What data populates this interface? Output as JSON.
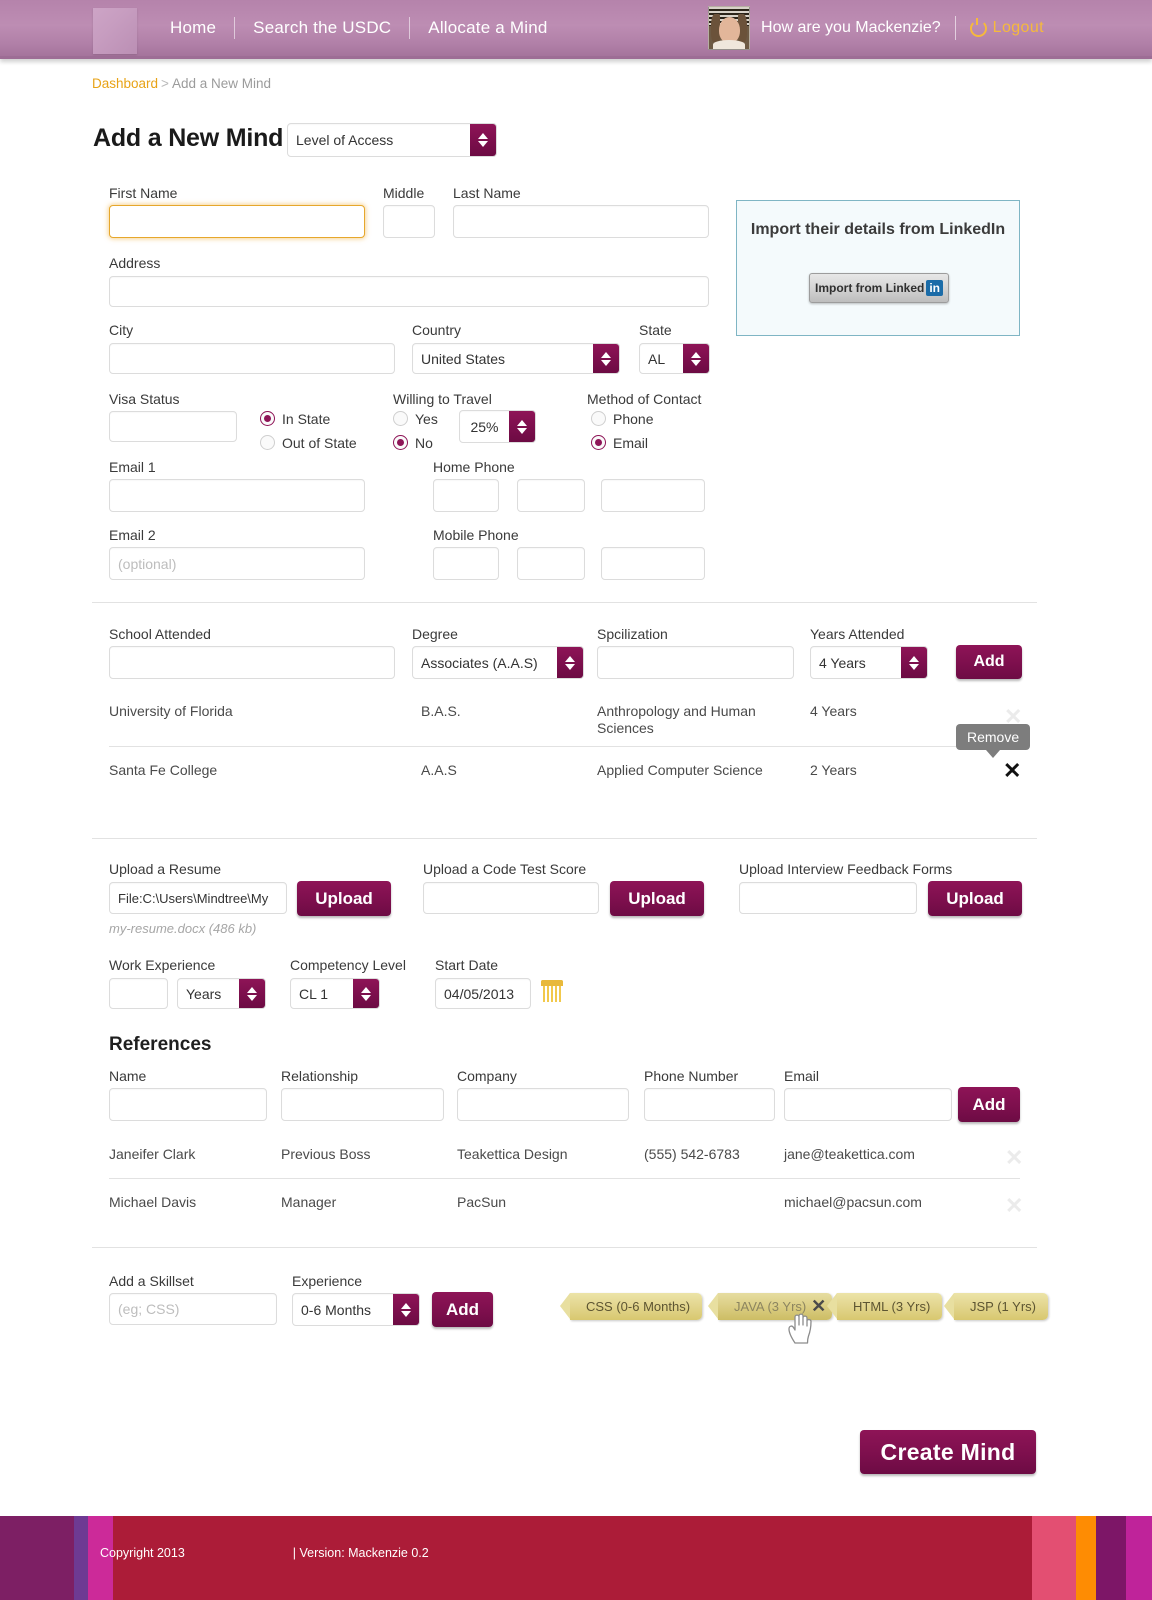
{
  "header": {
    "nav": [
      {
        "label": "Home",
        "name": "nav-home"
      },
      {
        "label": "Search the USDC",
        "name": "nav-search-usdc"
      },
      {
        "label": "Allocate a Mind",
        "name": "nav-allocate-a-mind"
      }
    ],
    "greeting": "How are you Mackenzie?",
    "logout_label": "Logout",
    "accent": "#b583ab",
    "logout_color": "#f6b93b"
  },
  "breadcrumb": {
    "root": "Dashboard",
    "sep": ">",
    "current": "Add a New Mind"
  },
  "page": {
    "title": "Add a New Mind",
    "access_select": "Level of Access"
  },
  "personal": {
    "first_name": {
      "label": "First Name",
      "value": ""
    },
    "middle": {
      "label": "Middle",
      "value": ""
    },
    "last_name": {
      "label": "Last Name",
      "value": ""
    },
    "address": {
      "label": "Address",
      "value": ""
    },
    "city": {
      "label": "City",
      "value": ""
    },
    "country": {
      "label": "Country",
      "value": "United States"
    },
    "state": {
      "label": "State",
      "value": "AL"
    },
    "visa_status": {
      "label": "Visa Status",
      "value": ""
    },
    "state_radio": [
      {
        "label": "In State",
        "selected": true
      },
      {
        "label": "Out of State",
        "selected": false
      }
    ],
    "willing_to_travel": {
      "label": "Willing to Travel",
      "options": [
        {
          "label": "Yes",
          "selected": false
        },
        {
          "label": "No",
          "selected": true
        }
      ],
      "percent": "25%"
    },
    "method_of_contact": {
      "label": "Method of Contact",
      "options": [
        {
          "label": "Phone",
          "selected": false
        },
        {
          "label": "Email",
          "selected": true
        }
      ]
    },
    "email1": {
      "label": "Email 1",
      "value": ""
    },
    "email2": {
      "label": "Email 2",
      "placeholder": "(optional)",
      "value": ""
    },
    "home_phone": {
      "label": "Home Phone",
      "parts": [
        "",
        "",
        ""
      ]
    },
    "mobile_phone": {
      "label": "Mobile Phone",
      "parts": [
        "",
        "",
        ""
      ]
    }
  },
  "linkedin": {
    "title": "Import their details from LinkedIn",
    "button_label": "Import from Linked",
    "button_badge": "in",
    "badge_color": "#1b6ca8"
  },
  "education": {
    "headers": [
      "School Attended",
      "Degree",
      "Spcilization",
      "Years Attended"
    ],
    "form": {
      "school": "",
      "degree": "Associates (A.A.S)",
      "specialization": "",
      "years": "4 Years",
      "add_label": "Add"
    },
    "rows": [
      {
        "school": "University of Florida",
        "degree": "B.A.S.",
        "specialization": "Anthropology and Human Sciences",
        "years": "4 Years"
      },
      {
        "school": "Santa Fe College",
        "degree": "A.A.S",
        "specialization": "Applied Computer Science",
        "years": "2 Years"
      }
    ],
    "tooltip": "Remove"
  },
  "uploads": [
    {
      "label": "Upload a Resume",
      "value": "File:C:\\Users\\Mindtree\\My",
      "button": "Upload",
      "note": "my-resume.docx (486 kb)"
    },
    {
      "label": "Upload a Code Test Score",
      "value": "",
      "button": "Upload",
      "note": ""
    },
    {
      "label": "Upload Interview Feedback Forms",
      "value": "",
      "button": "Upload",
      "note": ""
    }
  ],
  "experience": {
    "work_experience": {
      "label": "Work Experience",
      "value": "",
      "unit": "Years"
    },
    "competency": {
      "label": "Competency Level",
      "value": "CL 1"
    },
    "start_date": {
      "label": "Start Date",
      "value": "04/05/2013"
    }
  },
  "references": {
    "title": "References",
    "headers": [
      "Name",
      "Relationship",
      "Company",
      "Phone Number",
      "Email"
    ],
    "add_label": "Add",
    "form": {
      "name": "",
      "relationship": "",
      "company": "",
      "phone": "",
      "email": ""
    },
    "rows": [
      {
        "name": "Janeifer Clark",
        "relationship": "Previous Boss",
        "company": "Teakettica Design",
        "phone": "(555) 542-6783",
        "email": "jane@teakettica.com"
      },
      {
        "name": "Michael Davis",
        "relationship": "Manager",
        "company": "PacSun",
        "phone": "",
        "email": "michael@pacsun.com"
      }
    ]
  },
  "skills": {
    "add_label_text": "Add a Skillset",
    "placeholder": "(eg; CSS)",
    "value": "",
    "experience_label": "Experience",
    "experience_value": "0-6 Months",
    "add_button": "Add",
    "tags": [
      {
        "label": "CSS (0-6 Months)",
        "hover": false
      },
      {
        "label": "JAVA (3 Yrs)",
        "hover": true
      },
      {
        "label": "HTML (3 Yrs)",
        "hover": false
      },
      {
        "label": "JSP (1 Yrs)",
        "hover": false
      }
    ]
  },
  "submit": {
    "label": "Create Mind"
  },
  "footer": {
    "copyright": "Copyright 2013",
    "version": "| Version: Mackenzie 0.2",
    "main_color": "#ac1c38",
    "stripes_left": [
      "#7d1f64",
      "#6e3a93",
      "#cc2a99"
    ],
    "stripes_right": [
      "#e34f72",
      "#fe8c03",
      "#7d1667",
      "#bf239a"
    ]
  }
}
